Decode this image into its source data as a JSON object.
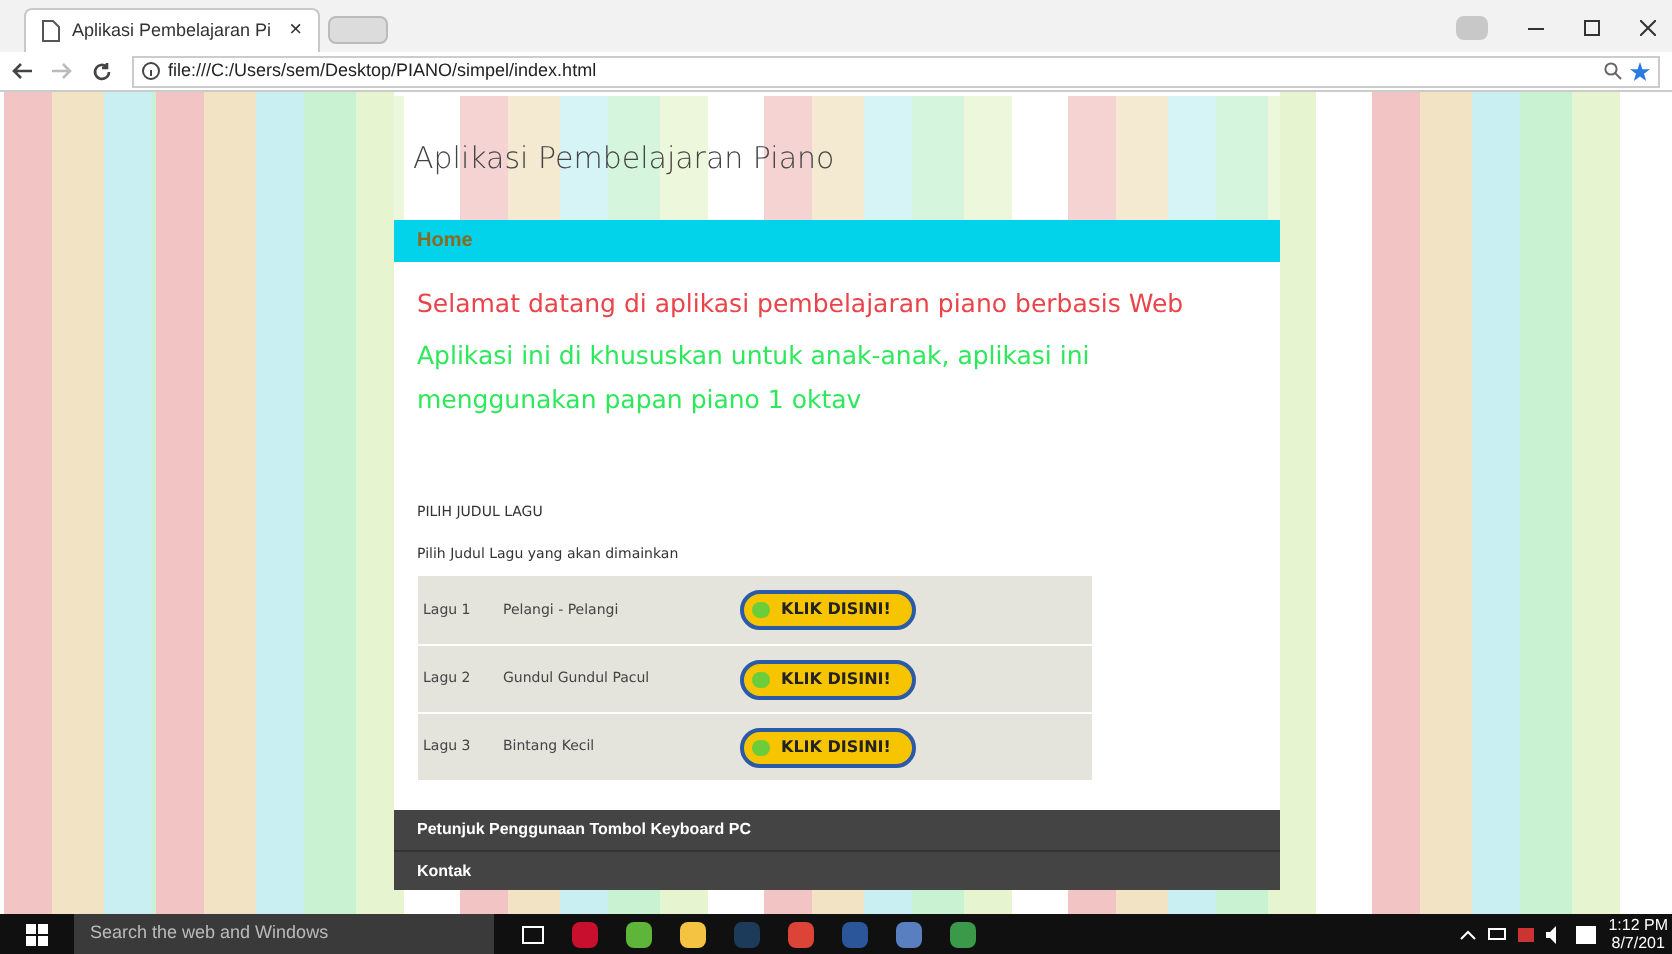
{
  "browser": {
    "tab_title": "Aplikasi Pembelajaran Pi",
    "tab_close": "×",
    "url": "file:///C:/Users/sem/Desktop/PIANO/simpel/index.html"
  },
  "site": {
    "title": "Aplikasi Pembelajaran Piano",
    "nav": [
      {
        "label": "Home",
        "selected": true
      }
    ],
    "welcome": "Selamat datang di aplikasi pembelajaran piano berbasis Web",
    "intro": "Aplikasi ini di khususkan untuk anak-anak, aplikasi ini menggunakan papan piano 1 oktav",
    "section_heading": "PILIH JUDUL LAGU",
    "section_text": "Pilih Judul Lagu yang akan dimainkan",
    "songs": [
      {
        "number": "Lagu 1",
        "title": "Pelangi - Pelangi",
        "button": "KLIK DISINI!"
      },
      {
        "number": "Lagu 2",
        "title": "Gundul Gundul Pacul",
        "button": "KLIK DISINI!"
      },
      {
        "number": "Lagu 3",
        "title": "Bintang Kecil",
        "button": "KLIK DISINI!"
      }
    ],
    "footer_links": [
      "Petunjuk Penggunaan Tombol Keyboard PC",
      "Kontak"
    ]
  },
  "taskbar": {
    "search_placeholder": "Search the web and Windows",
    "time": "1:12 PM",
    "date": "8/7/201"
  }
}
